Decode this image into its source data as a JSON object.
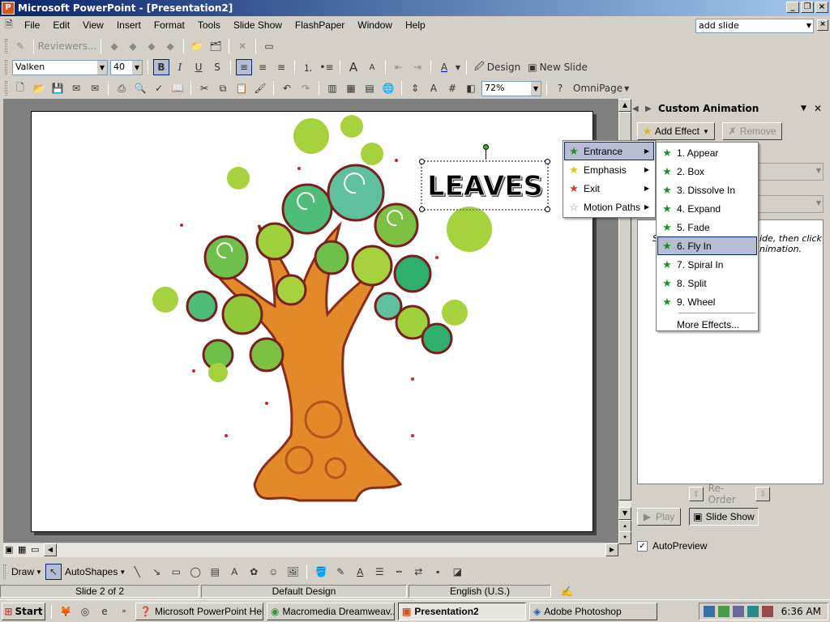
{
  "window": {
    "title": "Microsoft PowerPoint - [Presentation2]",
    "app_icon": "P"
  },
  "menubar": {
    "items": [
      "File",
      "Edit",
      "View",
      "Insert",
      "Format",
      "Tools",
      "Slide Show",
      "FlashPaper",
      "Window",
      "Help"
    ],
    "ask_box": "add slide"
  },
  "toolbar_review": {
    "reviewers_label": "Reviewers..."
  },
  "toolbar_format": {
    "font": "Valken",
    "size": "40",
    "bold": "B",
    "italic": "I",
    "underline": "U",
    "shadow": "S",
    "design_label": "Design",
    "new_slide_label": "New Slide"
  },
  "toolbar_standard": {
    "zoom": "72%",
    "omnipage_label": "OmniPage"
  },
  "slide": {
    "title_text": "LEAVES"
  },
  "task_pane": {
    "title": "Custom Animation",
    "add_effect_label": "Add Effect",
    "remove_label": "Remove",
    "hint_text": "ide, then click",
    "hint_text2": "nimation.",
    "hint_prefix": "S",
    "reorder_label": "Re-Order",
    "play_label": "Play",
    "slideshow_label": "Slide Show",
    "autopreview_label": "AutoPreview",
    "autopreview_checked": true
  },
  "add_effect_menu": {
    "items": [
      {
        "label": "Entrance",
        "icon": "green-star-icon",
        "selected": true
      },
      {
        "label": "Emphasis",
        "icon": "yellow-star-icon"
      },
      {
        "label": "Exit",
        "icon": "red-star-icon"
      },
      {
        "label": "Motion Paths",
        "icon": "outline-star-icon"
      }
    ]
  },
  "entrance_menu": {
    "items": [
      "1. Appear",
      "2. Box",
      "3. Dissolve In",
      "4. Expand",
      "5. Fade",
      "6. Fly In",
      "7. Spiral In",
      "8. Split",
      "9. Wheel"
    ],
    "highlighted": "6. Fly In",
    "more": "More Effects..."
  },
  "drawbar": {
    "draw_label": "Draw",
    "autoshapes_label": "AutoShapes"
  },
  "statusbar": {
    "slide": "Slide 2 of 2",
    "design": "Default Design",
    "language": "English (U.S.)"
  },
  "taskbar": {
    "start_label": "Start",
    "tasks": [
      "Microsoft PowerPoint Help",
      "Macromedia Dreamweav...",
      "Presentation2",
      "Adobe Photoshop"
    ],
    "active_task": "Presentation2",
    "clock": "6:36 AM"
  },
  "colors": {
    "title_gradient_start": "#0a246a",
    "title_gradient_end": "#a6caf0",
    "menu_highlight": "#b6bdd2",
    "tree_trunk": "#e0891e",
    "leaf_green": "#7cc142"
  }
}
